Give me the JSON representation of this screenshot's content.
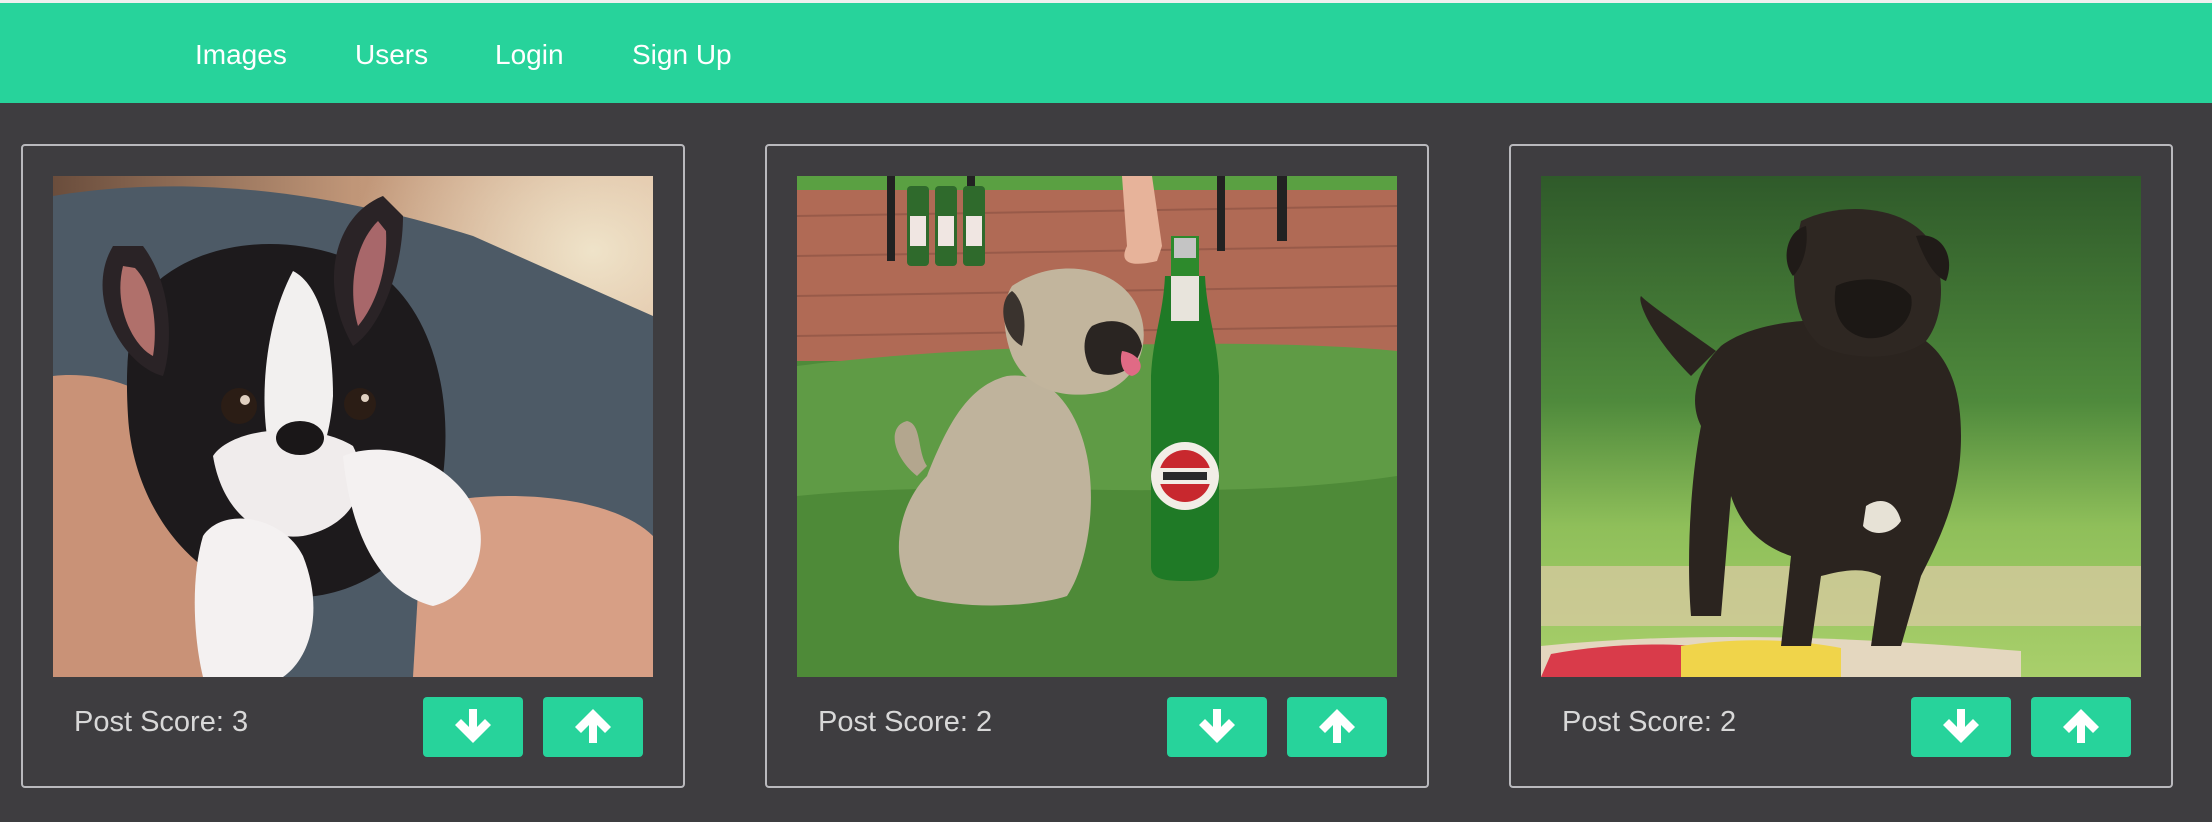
{
  "nav": {
    "links": [
      {
        "label": "Images"
      },
      {
        "label": "Users"
      },
      {
        "label": "Login"
      },
      {
        "label": "Sign Up"
      }
    ]
  },
  "colors": {
    "accent": "#27d39b",
    "background": "#3e3d40",
    "card_border": "#b9b9bd",
    "score_text": "#d8d8d8"
  },
  "posts": [
    {
      "score_text": "Post Score: 3",
      "score": 3,
      "image": "boston-terrier-puppy-photo",
      "downvote_icon": "arrow-down-icon",
      "upvote_icon": "arrow-up-icon"
    },
    {
      "score_text": "Post Score: 2",
      "score": 2,
      "image": "pug-puppy-with-beer-bottle-photo",
      "downvote_icon": "arrow-down-icon",
      "upvote_icon": "arrow-up-icon"
    },
    {
      "score_text": "Post Score: 2",
      "score": 2,
      "image": "brindle-puppy-on-grass-photo",
      "downvote_icon": "arrow-down-icon",
      "upvote_icon": "arrow-up-icon"
    }
  ]
}
